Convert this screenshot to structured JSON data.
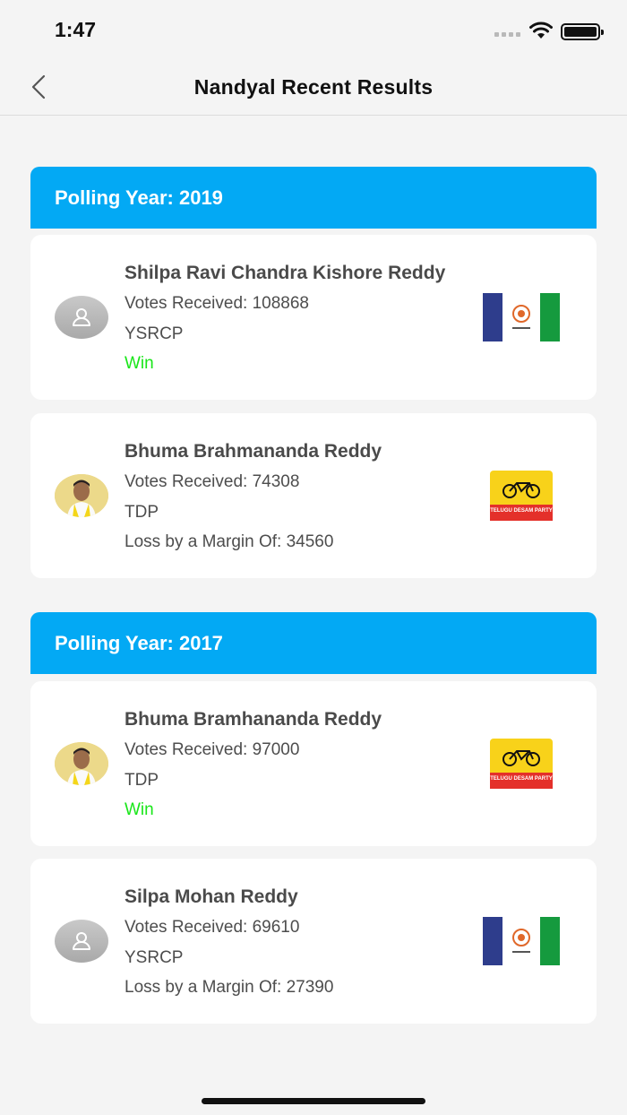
{
  "status_bar": {
    "time": "1:47"
  },
  "nav": {
    "title": "Nandyal Recent Results"
  },
  "colors": {
    "header_blue": "#03a9f4",
    "win_green": "#19e619",
    "ysrcp_blue": "#2e3d8c",
    "ysrcp_green": "#159a3e",
    "tdp_yellow": "#f8d21a",
    "tdp_red": "#e4302a"
  },
  "sections": [
    {
      "year_label": "Polling Year:  2019",
      "candidates": [
        {
          "name": "Shilpa Ravi Chandra Kishore Reddy",
          "votes": "Votes Received: 108868",
          "party": "YSRCP",
          "result": "Win",
          "avatar": "person-placeholder-icon",
          "logo": "ysrcp-flag-logo"
        },
        {
          "name": "Bhuma Brahmananda Reddy",
          "votes": "Votes Received: 74308",
          "party": "TDP",
          "result": "Loss by a Margin Of:  34560",
          "avatar": "candidate-photo",
          "logo": "tdp-bicycle-logo",
          "logo_text": "TELUGU DESAM PARTY"
        }
      ]
    },
    {
      "year_label": "Polling Year:  2017",
      "candidates": [
        {
          "name": "Bhuma Bramhananda Reddy",
          "votes": "Votes Received: 97000",
          "party": "TDP",
          "result": "Win",
          "avatar": "candidate-photo",
          "logo": "tdp-bicycle-logo",
          "logo_text": "TELUGU DESAM PARTY"
        },
        {
          "name": "Silpa Mohan Reddy",
          "votes": "Votes Received: 69610",
          "party": "YSRCP",
          "result": "Loss by a Margin Of:  27390",
          "avatar": "person-placeholder-icon",
          "logo": "ysrcp-flag-logo"
        }
      ]
    }
  ]
}
